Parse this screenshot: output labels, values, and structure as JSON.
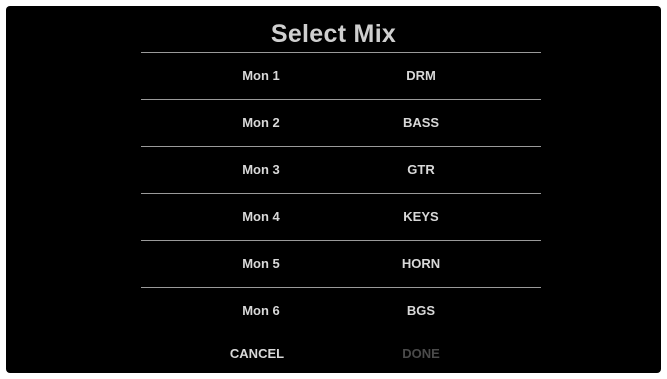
{
  "dialog": {
    "title": "Select Mix"
  },
  "mixes": [
    {
      "monitor": "Mon 1",
      "name": "DRM"
    },
    {
      "monitor": "Mon 2",
      "name": "BASS"
    },
    {
      "monitor": "Mon 3",
      "name": "GTR"
    },
    {
      "monitor": "Mon 4",
      "name": "KEYS"
    },
    {
      "monitor": "Mon 5",
      "name": "HORN"
    },
    {
      "monitor": "Mon 6",
      "name": "BGS"
    }
  ],
  "actions": {
    "cancel_label": "CANCEL",
    "done_label": "DONE",
    "done_enabled": false
  },
  "colors": {
    "background": "#000000",
    "text": "#d8d8d8",
    "divider": "#9a9a9a",
    "disabled_text": "#4a4a4a"
  }
}
